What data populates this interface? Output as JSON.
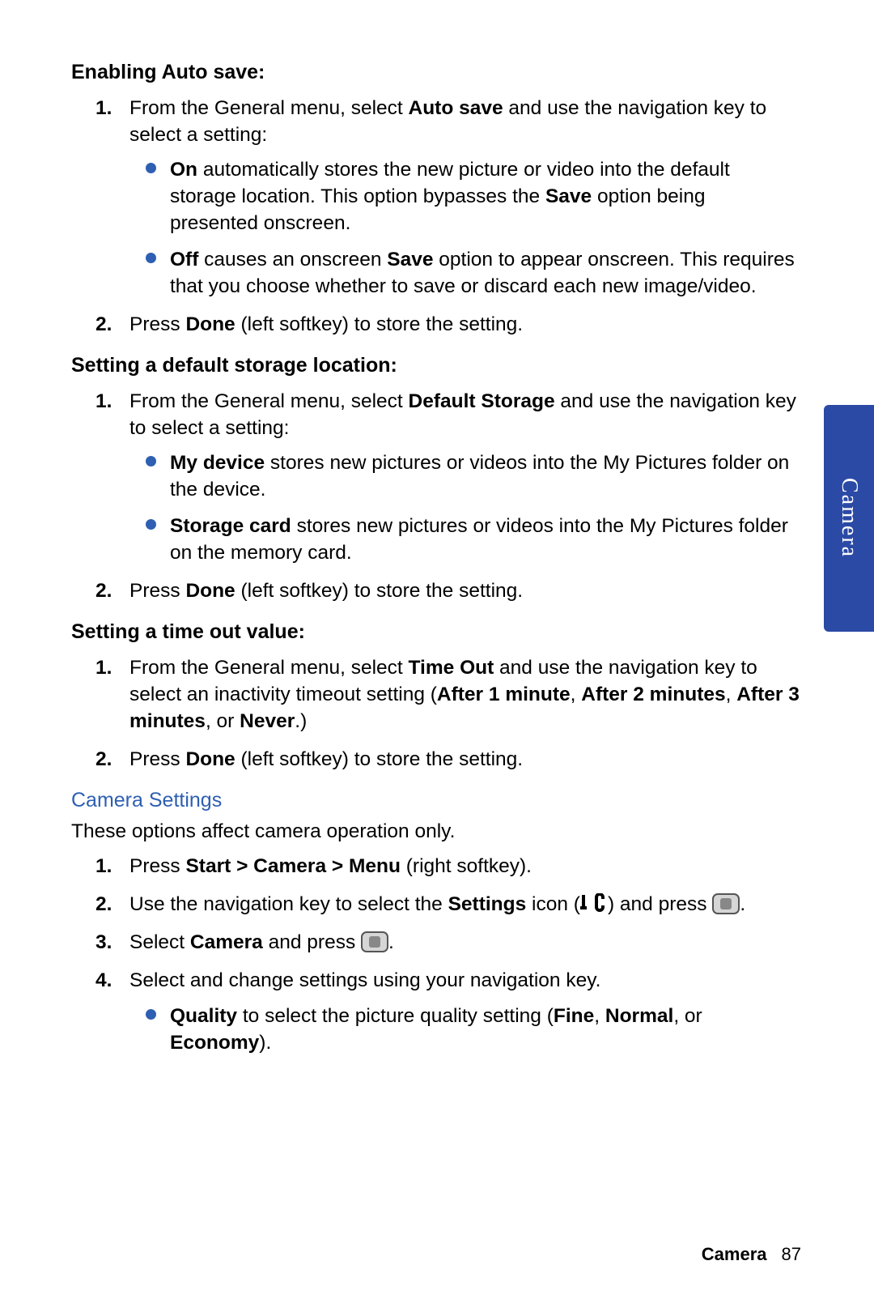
{
  "section1": {
    "heading": "Enabling Auto save:",
    "step1_pre": "From the General menu, select ",
    "step1_bold": "Auto save",
    "step1_post": " and use the navigation key to select a setting:",
    "bullets": [
      {
        "lead": "On",
        "text": " automatically stores the new picture or video into the default storage location. This option bypasses the ",
        "bold2": "Save",
        "text2": " option being presented onscreen."
      },
      {
        "lead": "Off",
        "text": " causes an onscreen ",
        "bold2": "Save",
        "text2": " option to appear onscreen. This requires that you choose whether to save or discard each new image/video."
      }
    ],
    "step2_pre": "Press ",
    "step2_bold": "Done",
    "step2_post": " (left softkey) to store the setting."
  },
  "section2": {
    "heading": "Setting a default storage location:",
    "step1_pre": "From the General menu, select ",
    "step1_bold": "Default Storage",
    "step1_post": " and use the navigation key to select a setting:",
    "bullets": [
      {
        "lead": "My device",
        "text": " stores new pictures or videos into the My Pictures folder on the device."
      },
      {
        "lead": "Storage card",
        "text": " stores new pictures or videos into the My Pictures folder on the memory card."
      }
    ],
    "step2_pre": "Press ",
    "step2_bold": "Done",
    "step2_post": " (left softkey) to store the setting."
  },
  "section3": {
    "heading": "Setting a time out value:",
    "step1_pre": "From the General menu, select ",
    "step1_bold": "Time Out",
    "step1_mid": " and use the navigation key to select an inactivity timeout setting (",
    "opt1": "After 1 minute",
    "sep1": ", ",
    "opt2": "After 2 minutes",
    "sep2": ", ",
    "opt3": "After 3 minutes",
    "sep3": ", or ",
    "opt4": "Never",
    "step1_end": ".)",
    "step2_pre": "Press ",
    "step2_bold": "Done",
    "step2_post": " (left softkey) to store the setting."
  },
  "camSettings": {
    "heading": "Camera Settings",
    "intro": "These options affect camera operation only.",
    "s1_pre": "Press ",
    "s1_bold": "Start > Camera > Menu",
    "s1_post": " (right softkey).",
    "s2_pre": "Use the navigation key to select the ",
    "s2_bold": "Settings",
    "s2_mid": " icon (",
    "s2_post": ") and press ",
    "s2_end": ".",
    "s3_pre": "Select ",
    "s3_bold": "Camera",
    "s3_mid": " and press ",
    "s3_end": ".",
    "s4": "Select and change settings using your navigation key.",
    "bullet_lead": "Quality",
    "bullet_mid": " to select the picture quality setting (",
    "q1": "Fine",
    "qs1": ", ",
    "q2": "Normal",
    "qs2": ", or ",
    "q3": "Economy",
    "bullet_end": ")."
  },
  "tab": "Camera",
  "footer": {
    "section": "Camera",
    "page": "87"
  },
  "nums": {
    "n1": "1.",
    "n2": "2.",
    "n3": "3.",
    "n4": "4."
  }
}
